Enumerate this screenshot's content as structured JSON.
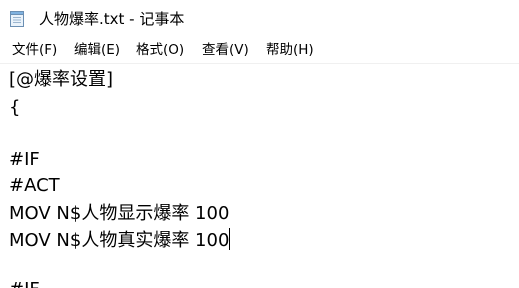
{
  "window": {
    "title": "人物爆率.txt - 记事本"
  },
  "menu": {
    "items": [
      {
        "label": "文件(F)"
      },
      {
        "label": "编辑(E)"
      },
      {
        "label": "格式(O)"
      },
      {
        "label": "查看(V)"
      },
      {
        "label": "帮助(H)"
      }
    ]
  },
  "editor": {
    "lines": [
      "[@爆率设置]",
      "{",
      "",
      "#IF",
      "#ACT",
      "MOV N$人物显示爆率 100",
      "MOV N$人物真实爆率 100",
      "",
      "#IF"
    ]
  },
  "icons": {
    "app": "notepad-icon"
  }
}
